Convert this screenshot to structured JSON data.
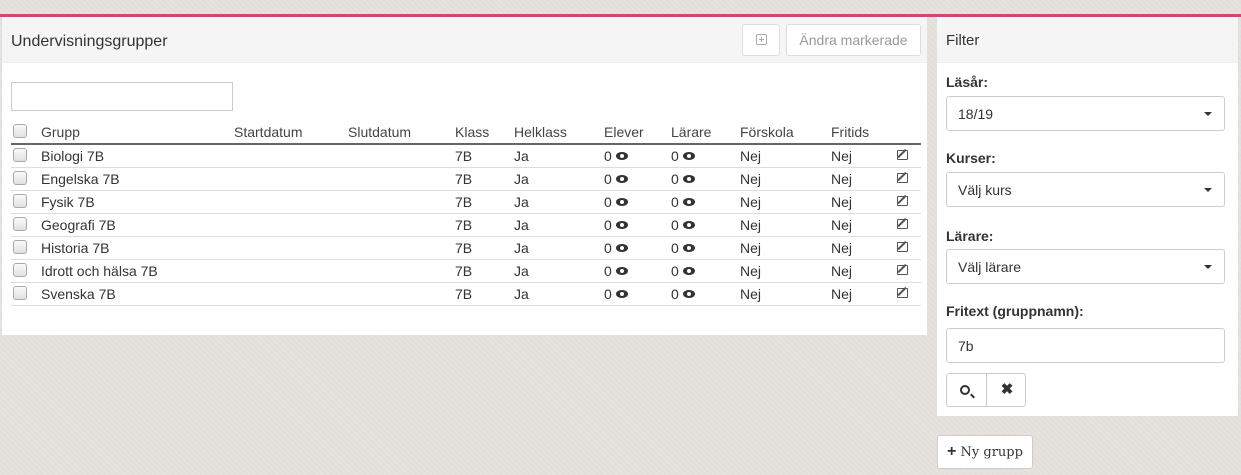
{
  "main": {
    "title": "Undervisningsgrupper",
    "change_selected_label": "Ändra markerade",
    "search_value": "",
    "columns": {
      "group": "Grupp",
      "start": "Startdatum",
      "end": "Slutdatum",
      "class": "Klass",
      "whole_class": "Helklass",
      "students": "Elever",
      "teachers": "Lärare",
      "preschool": "Förskola",
      "after_school": "Fritids"
    },
    "rows": [
      {
        "group": "Biologi 7B",
        "start": "",
        "end": "",
        "class": "7B",
        "whole_class": "Ja",
        "students": "0",
        "teachers": "0",
        "preschool": "Nej",
        "after_school": "Nej"
      },
      {
        "group": "Engelska 7B",
        "start": "",
        "end": "",
        "class": "7B",
        "whole_class": "Ja",
        "students": "0",
        "teachers": "0",
        "preschool": "Nej",
        "after_school": "Nej"
      },
      {
        "group": "Fysik 7B",
        "start": "",
        "end": "",
        "class": "7B",
        "whole_class": "Ja",
        "students": "0",
        "teachers": "0",
        "preschool": "Nej",
        "after_school": "Nej"
      },
      {
        "group": "Geografi 7B",
        "start": "",
        "end": "",
        "class": "7B",
        "whole_class": "Ja",
        "students": "0",
        "teachers": "0",
        "preschool": "Nej",
        "after_school": "Nej"
      },
      {
        "group": "Historia 7B",
        "start": "",
        "end": "",
        "class": "7B",
        "whole_class": "Ja",
        "students": "0",
        "teachers": "0",
        "preschool": "Nej",
        "after_school": "Nej"
      },
      {
        "group": "Idrott och hälsa 7B",
        "start": "",
        "end": "",
        "class": "7B",
        "whole_class": "Ja",
        "students": "0",
        "teachers": "0",
        "preschool": "Nej",
        "after_school": "Nej"
      },
      {
        "group": "Svenska 7B",
        "start": "",
        "end": "",
        "class": "7B",
        "whole_class": "Ja",
        "students": "0",
        "teachers": "0",
        "preschool": "Nej",
        "after_school": "Nej"
      }
    ]
  },
  "filter": {
    "title": "Filter",
    "school_year_label": "Läsår:",
    "school_year_value": "18/19",
    "courses_label": "Kurser:",
    "courses_value": "Välj kurs",
    "teachers_label": "Lärare:",
    "teachers_value": "Välj lärare",
    "freetext_label": "Fritext (gruppnamn):",
    "freetext_value": "7b",
    "clear_glyph": "✖"
  },
  "new_group_label": "Ny grupp",
  "icons": {
    "expand": "plus-square-icon",
    "students": "eye-icon",
    "teachers": "eye-icon",
    "edit": "edit-icon",
    "search": "search-icon",
    "clear": "close-icon",
    "dropdown": "caret-down-icon",
    "new": "plus-icon"
  },
  "colors": {
    "accent": "#d4457c"
  }
}
